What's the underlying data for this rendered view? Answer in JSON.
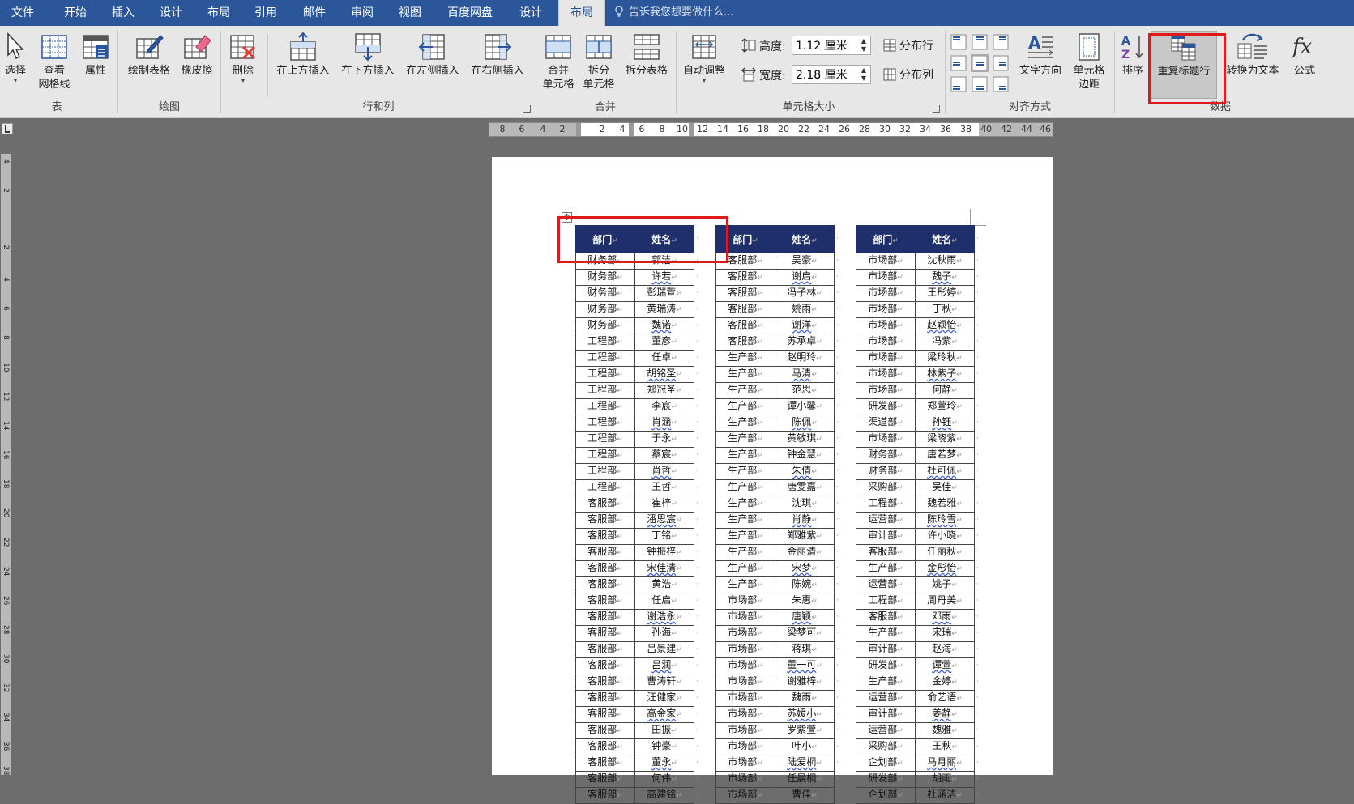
{
  "tabs": [
    {
      "label": "文件",
      "active": false
    },
    {
      "label": "开始",
      "active": false
    },
    {
      "label": "插入",
      "active": false
    },
    {
      "label": "设计",
      "active": false
    },
    {
      "label": "布局",
      "active": false
    },
    {
      "label": "引用",
      "active": false
    },
    {
      "label": "邮件",
      "active": false
    },
    {
      "label": "审阅",
      "active": false
    },
    {
      "label": "视图",
      "active": false
    },
    {
      "label": "百度网盘",
      "active": false
    },
    {
      "label": "设计",
      "active": false
    },
    {
      "label": "布局",
      "active": true
    }
  ],
  "tell_me": {
    "placeholder": "告诉我您想要做什么..."
  },
  "ribbon": {
    "groups": {
      "table": "表",
      "draw": "绘图",
      "rows_cols": "行和列",
      "merge": "合并",
      "cell_size": "单元格大小",
      "alignment": "对齐方式",
      "data": "数据"
    },
    "select": "选择",
    "view_grid_1": "查看",
    "view_grid_2": "网格线",
    "properties": "属性",
    "draw_table": "绘制表格",
    "eraser": "橡皮擦",
    "delete": "删除",
    "insert_above": "在上方插入",
    "insert_below": "在下方插入",
    "insert_left": "在左侧插入",
    "insert_right": "在右侧插入",
    "merge_cells_1": "合并",
    "merge_cells_2": "单元格",
    "split_cells_1": "拆分",
    "split_cells_2": "单元格",
    "split_table": "拆分表格",
    "autofit": "自动调整",
    "height_label": "高度:",
    "height_value": "1.12 厘米",
    "width_label": "宽度:",
    "width_value": "2.18 厘米",
    "distribute_rows": "分布行",
    "distribute_cols": "分布列",
    "text_direction": "文字方向",
    "cell_margins_1": "单元格",
    "cell_margins_2": "边距",
    "sort": "排序",
    "repeat_header": "重复标题行",
    "convert_text": "转换为文本",
    "formula": "公式"
  },
  "ruler": {
    "h_left": [
      "8",
      "6",
      "4",
      "2"
    ],
    "h_right": [
      "2",
      "4",
      "6",
      "8",
      "10",
      "12",
      "14",
      "16",
      "18",
      "20",
      "22",
      "24",
      "26",
      "28",
      "30",
      "32",
      "34",
      "36",
      "38",
      "40",
      "42",
      "44",
      "46"
    ],
    "v": [
      "4",
      "2",
      "2",
      "4",
      "6",
      "8",
      "10",
      "12",
      "14",
      "16",
      "18",
      "20",
      "22",
      "24",
      "26",
      "28",
      "30",
      "32",
      "34",
      "36",
      "38"
    ]
  },
  "document": {
    "headers": [
      "部门",
      "姓名"
    ],
    "columns": [
      [
        [
          "财务部",
          "郭洁"
        ],
        [
          "财务部",
          "许若"
        ],
        [
          "财务部",
          "彭瑞萱"
        ],
        [
          "财务部",
          "黄瑞涛"
        ],
        [
          "财务部",
          "魏诺"
        ],
        [
          "工程部",
          "董彦"
        ],
        [
          "工程部",
          "任卓"
        ],
        [
          "工程部",
          "胡铭圣"
        ],
        [
          "工程部",
          "郑冠圣"
        ],
        [
          "工程部",
          "李宸"
        ],
        [
          "工程部",
          "肖涵"
        ],
        [
          "工程部",
          "于永"
        ],
        [
          "工程部",
          "蔡宸"
        ],
        [
          "工程部",
          "肖哲"
        ],
        [
          "工程部",
          "王哲"
        ],
        [
          "客服部",
          "崔梓"
        ],
        [
          "客服部",
          "潘思宸"
        ],
        [
          "客服部",
          "丁铭"
        ],
        [
          "客服部",
          "钟振梓"
        ],
        [
          "客服部",
          "宋佳清"
        ],
        [
          "客服部",
          "黄浩"
        ],
        [
          "客服部",
          "任启"
        ],
        [
          "客服部",
          "谢浩永"
        ],
        [
          "客服部",
          "孙海"
        ],
        [
          "客服部",
          "吕景建"
        ],
        [
          "客服部",
          "吕润"
        ],
        [
          "客服部",
          "曹涛轩"
        ],
        [
          "客服部",
          "汪健家"
        ],
        [
          "客服部",
          "高金家"
        ],
        [
          "客服部",
          "田振"
        ],
        [
          "客服部",
          "钟豪"
        ],
        [
          "客服部",
          "董永"
        ],
        [
          "客服部",
          "何伟"
        ],
        [
          "客服部",
          "高建铭"
        ]
      ],
      [
        [
          "客服部",
          "吴豪"
        ],
        [
          "客服部",
          "谢启"
        ],
        [
          "客服部",
          "冯子林"
        ],
        [
          "客服部",
          "姚雨"
        ],
        [
          "客服部",
          "谢洋"
        ],
        [
          "客服部",
          "苏承卓"
        ],
        [
          "生产部",
          "赵明玲"
        ],
        [
          "生产部",
          "马清"
        ],
        [
          "生产部",
          "范思"
        ],
        [
          "生产部",
          "谭小馨"
        ],
        [
          "生产部",
          "陈佩"
        ],
        [
          "生产部",
          "黄敏琪"
        ],
        [
          "生产部",
          "钟金慧"
        ],
        [
          "生产部",
          "朱倩"
        ],
        [
          "生产部",
          "唐雯嘉"
        ],
        [
          "生产部",
          "沈琪"
        ],
        [
          "生产部",
          "肖静"
        ],
        [
          "生产部",
          "郑雅紫"
        ],
        [
          "生产部",
          "金丽清"
        ],
        [
          "生产部",
          "宋梦"
        ],
        [
          "生产部",
          "陈婉"
        ],
        [
          "市场部",
          "朱惠"
        ],
        [
          "市场部",
          "唐颖"
        ],
        [
          "市场部",
          "梁梦可"
        ],
        [
          "市场部",
          "蒋琪"
        ],
        [
          "市场部",
          "董一可"
        ],
        [
          "市场部",
          "谢雅梓"
        ],
        [
          "市场部",
          "魏雨"
        ],
        [
          "市场部",
          "苏媛小"
        ],
        [
          "市场部",
          "罗紫萱"
        ],
        [
          "市场部",
          "叶小"
        ],
        [
          "市场部",
          "陆爱桐"
        ],
        [
          "市场部",
          "任晨桐"
        ],
        [
          "市场部",
          "曹佳"
        ]
      ],
      [
        [
          "市场部",
          "沈秋雨"
        ],
        [
          "市场部",
          "魏子"
        ],
        [
          "市场部",
          "王彤婷"
        ],
        [
          "市场部",
          "丁秋"
        ],
        [
          "市场部",
          "赵颖怡"
        ],
        [
          "市场部",
          "冯紫"
        ],
        [
          "市场部",
          "梁玲秋"
        ],
        [
          "市场部",
          "林紫子"
        ],
        [
          "市场部",
          "何静"
        ],
        [
          "研发部",
          "郑萱玲"
        ],
        [
          "渠道部",
          "孙钰"
        ],
        [
          "市场部",
          "梁晓紫"
        ],
        [
          "财务部",
          "唐若梦"
        ],
        [
          "财务部",
          "杜可佩"
        ],
        [
          "采购部",
          "吴佳"
        ],
        [
          "工程部",
          "魏若雅"
        ],
        [
          "运营部",
          "陈玲雪"
        ],
        [
          "审计部",
          "许小晓"
        ],
        [
          "客服部",
          "任丽秋"
        ],
        [
          "生产部",
          "金彤怡"
        ],
        [
          "运营部",
          "姚子"
        ],
        [
          "工程部",
          "周丹美"
        ],
        [
          "客服部",
          "邓雨"
        ],
        [
          "生产部",
          "宋瑞"
        ],
        [
          "审计部",
          "赵海"
        ],
        [
          "研发部",
          "谭萱"
        ],
        [
          "生产部",
          "金婷"
        ],
        [
          "运营部",
          "俞艺语"
        ],
        [
          "审计部",
          "姜静"
        ],
        [
          "运营部",
          "魏雅"
        ],
        [
          "采购部",
          "王秋"
        ],
        [
          "企划部",
          "马月丽"
        ],
        [
          "研发部",
          "胡雨"
        ],
        [
          "企划部",
          "杜涵洁"
        ]
      ]
    ]
  }
}
